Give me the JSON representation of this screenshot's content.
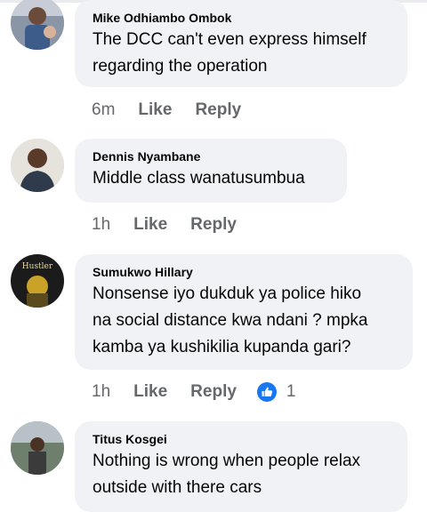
{
  "comments": [
    {
      "author": "Mike Odhiambo Ombok",
      "text_lines": [
        "The DCC can't even express himself",
        "regarding the operation"
      ],
      "time": "6m",
      "like_label": "Like",
      "reply_label": "Reply"
    },
    {
      "author": "Dennis Nyambane",
      "text_lines": [
        "Middle class wanatusumbua"
      ],
      "time": "1h",
      "like_label": "Like",
      "reply_label": "Reply"
    },
    {
      "author": "Sumukwo Hillary",
      "avatar_text": "Hustler",
      "text_lines": [
        "Nonsense iyo dukduk ya police hiko",
        "na social distance kwa ndani ? mpka",
        "kamba ya kushikilia kupanda gari?"
      ],
      "time": "1h",
      "like_label": "Like",
      "reply_label": "Reply",
      "reaction_icon": "thumbs-up-icon",
      "reaction_count": "1"
    },
    {
      "author": "Titus Kosgei",
      "text_lines": [
        "Nothing is wrong when people relax",
        "outside with there cars"
      ]
    }
  ],
  "colors": {
    "bubble": "#f0f2f5",
    "meta": "#65676b",
    "like_blue": "#1877f2"
  }
}
